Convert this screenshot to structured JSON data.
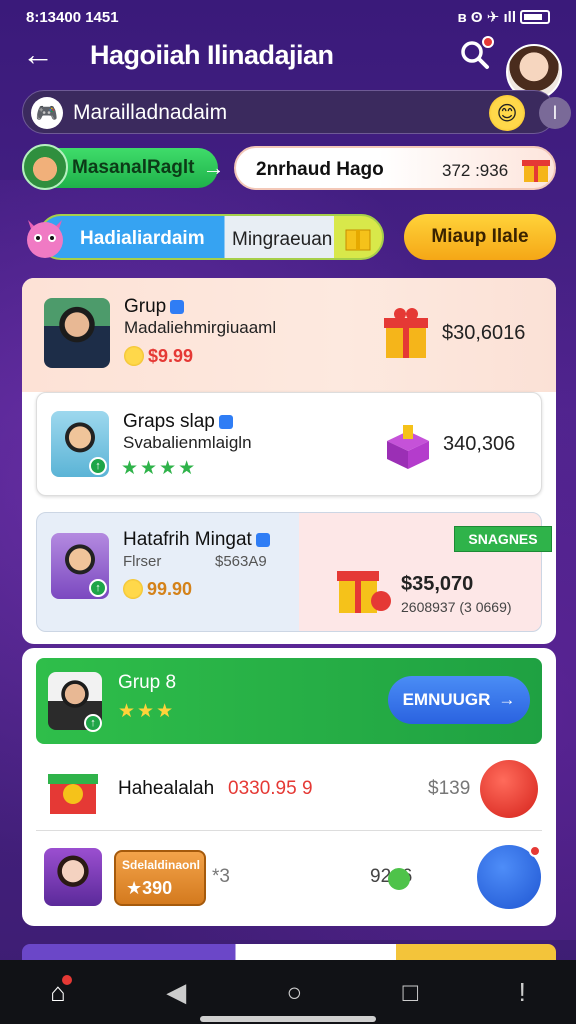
{
  "status_bar": {
    "time": "8:13400 1451",
    "icons_left": "▪ ▪",
    "icons_right": "ʙ ʘ ✈ ıll"
  },
  "header": {
    "title": "Hagoiiah Ilinadajian",
    "back_icon": "back-arrow-icon",
    "search_icon": "search-icon"
  },
  "search": {
    "text": "Marailladnadaim",
    "emoji": "😊",
    "mic": "mic-icon"
  },
  "chips": {
    "green_label": "MasanalRaglt",
    "green_arrow": "→",
    "white_label": "2nrhaud Hago",
    "white_value": "372 :936"
  },
  "category": {
    "label_a": "Hadialiardaim",
    "label_b": "Mingraeuan",
    "yellow_button": "Miaup Ilale"
  },
  "cards": [
    {
      "name": "Grup",
      "sub": "Madaliehmirgiuaaml",
      "price": "$9.99",
      "amount": "$30,6016"
    },
    {
      "name": "Graps slap",
      "sub": "Svabalienmlaigln",
      "amount": "340,306",
      "stars": "★★★★"
    },
    {
      "name": "Hatafrih Mingat",
      "sub": "Flrser",
      "sub_price": "$563A9",
      "price": "99.90",
      "badge": "SNAGNES",
      "amount": "$35,070",
      "detail": "2608937 (3 0669)"
    }
  ],
  "green_section": {
    "name": "Grup 8",
    "stars": "★★★",
    "button": "EMNUUGR",
    "button_arrow": "→"
  },
  "list_rows": [
    {
      "label": "Hahealalah",
      "value": "0330.95 9",
      "price": "$139"
    },
    {
      "tag": "Sdelaldinaonl",
      "tag_value": "★390",
      "extra": "*3",
      "price": "9266"
    }
  ],
  "nav": {
    "home": "⌂",
    "back": "◀",
    "circle": "○",
    "square": "□",
    "info": "!"
  }
}
